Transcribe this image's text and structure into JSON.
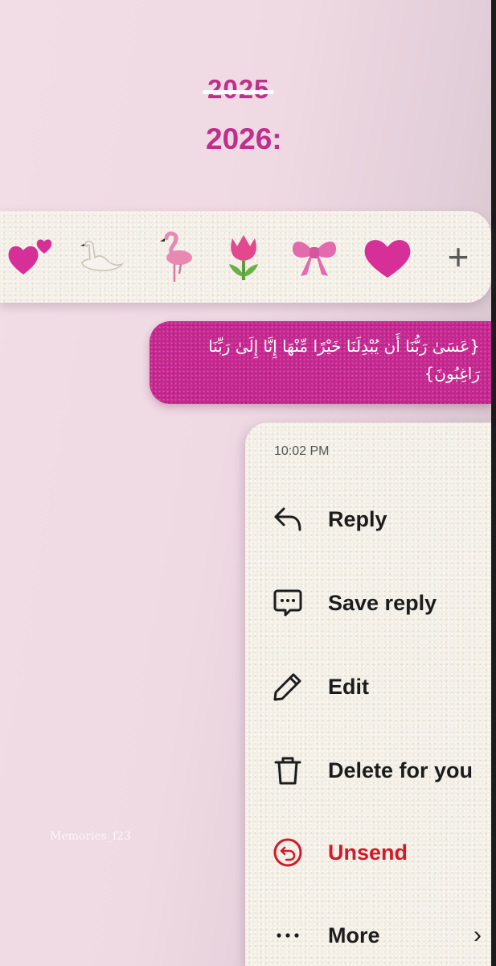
{
  "header": {
    "old_year": "2025",
    "new_year": "2026:"
  },
  "reactions": {
    "items": [
      "two-hearts-icon",
      "swan-icon",
      "flamingo-icon",
      "tulip-icon",
      "bow-icon",
      "heart-icon",
      "add-reaction-icon"
    ],
    "plus_label": "+"
  },
  "message": {
    "text": "{عَسَىٰ رَبُّنَا أَن يُبْدِلَنَا خَيْرًا مِّنْهَا إِنَّا إِلَىٰ رَبِّنَا\nرَاغِبُونَ}"
  },
  "menu": {
    "timestamp": "10:02 PM",
    "items": [
      {
        "label": "Reply",
        "icon": "reply-icon"
      },
      {
        "label": "Save reply",
        "icon": "chat-dots-icon"
      },
      {
        "label": "Edit",
        "icon": "pencil-icon"
      },
      {
        "label": "Delete for you",
        "icon": "trash-icon"
      },
      {
        "label": "Unsend",
        "icon": "unsend-icon"
      },
      {
        "label": "More",
        "icon": "more-icon"
      }
    ],
    "more_chevron": "›"
  },
  "watermark": "Memories_f23",
  "colors": {
    "accent": "#bf2f8c",
    "bubble": "#c5268f",
    "danger": "#d11a2a",
    "felt": "#f3efe6"
  }
}
